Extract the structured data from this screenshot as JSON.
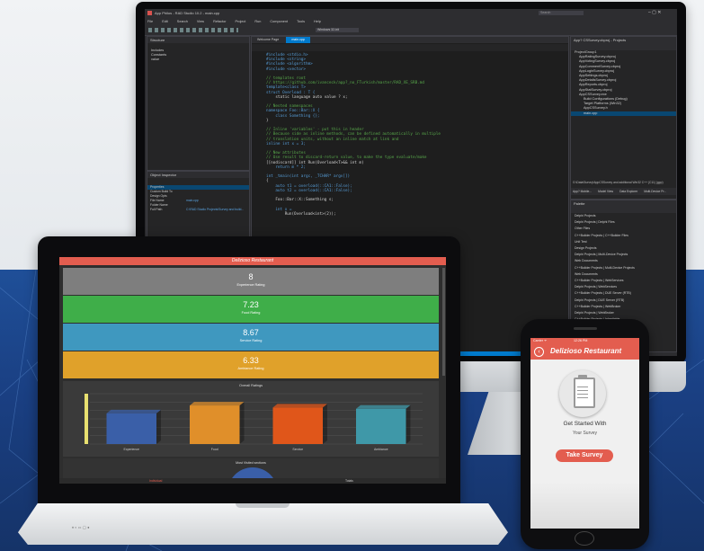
{
  "ide": {
    "title": "App Philos - RAD Studio 10.2 - main.cpp",
    "search_placeholder": "Search",
    "menu": [
      "File",
      "Edit",
      "Search",
      "View",
      "Refactor",
      "Project",
      "Run",
      "Component",
      "Tools",
      "Help"
    ],
    "platform_select": "Windows 32-bit",
    "structure_title": "Structure",
    "structure_items": [
      "Includes",
      "Constants",
      "value"
    ],
    "inspector_title": "Object Inspector",
    "inspector_tabs": [
      "Properties",
      "Events"
    ],
    "inspector_rows": [
      [
        "Properties",
        ""
      ],
      [
        "Custom Build To",
        ""
      ],
      [
        "Design Opts",
        ""
      ],
      [
        "File Name",
        "main.cpp"
      ],
      [
        "Folder Name",
        ""
      ],
      [
        "Full Path",
        "C:\\RAD Studio Projects\\Survey and build..."
      ]
    ],
    "tabs": [
      "Welcome Page",
      "main.cpp"
    ],
    "code_lines": [
      "#include <stdio.h>",
      "#include <string>",
      "#include <algorithm>",
      "#include <vector>",
      "",
      "// templates root",
      "// https://github.com/ivanceck/app?_no_FTurkish/master/RAD_XE_SRB.md",
      "template<class T>",
      "struct Overload : T {",
      "    static language auto value ? x;",
      "",
      "// Nested namespaces",
      "namespace Foo::Bar::X {",
      "    class Something {};",
      "}",
      "",
      "// Inline 'variables' - put this in header",
      "// Because side as inline methods, can be defined automatically in multiple",
      "// translation units, without an inline match at link and",
      "inline int x = 3;",
      "",
      "// New attributes",
      "// Use result to discard-return value, to make the type evaluate/make",
      "[[nodiscard]] int Run(Overload<T>&& int m)",
      "    return m * 2;",
      "",
      "int _tmain(int argc, _TCHAR* argv[])",
      "{",
      "    auto t1 = overload(::CA1::False);",
      "    auto t2 = overload(::CA1::False);",
      "",
      "    Foo::Bar::X::Something s;",
      "",
      "    int x =",
      "        Run(Overload<int>(2));"
    ],
    "project_title": "App? CSSurvey.cbproj - Projects",
    "project_items": [
      "ProjectGroup1",
      "AppRatingSurvey.cbproj",
      "AppVotingSurvey.cbproj",
      "AppCommentSurvey.cbproj",
      "AppLoginSurvey.cbproj",
      "AppSettings.cbproj",
      "AppDetailsSurvey.cbproj",
      "AppReports.cbproj",
      "AppStatSurvey.cbproj",
      "AppCSSurvey.exe",
      "Build Configurations (Debug)",
      "Target Platforms (Win32)",
      "AppCSSurvey.h",
      "main.cpp"
    ],
    "project_status": "G:\\Data\\Survey\\AppCSSurvey and additional Win32 C++ (C11) (gpp)",
    "project_tabs": [
      "App? Mobile...",
      "Model View",
      "Data Explorer",
      "Multi-Device Pr..."
    ],
    "palette_title": "Palette",
    "palette_items": [
      "Delphi Projects",
      "Delphi Projects | Delphi Files",
      "Other Files",
      "C++Builder Projects | C++Builder Files",
      "Unit Test",
      "Design Projects",
      "Delphi Projects | Multi-Device Projects",
      "Web Documents",
      "C++Builder Projects | Multi-Device Projects",
      "Web Documents",
      "C++Builder Projects | WebServices",
      "Delphi Projects | WebServices",
      "C++Builder Projects | DUE Server (RTB)",
      "Delphi Projects | DUE Server (RTB)",
      "C++Builder Projects | WebBroker",
      "Delphi Projects | WebBroker",
      "C++Builder Projects | Inheritable",
      "Delphi Projects | Inheritable",
      "C++Builder Projects | DataSnap Server",
      "Delphi Projects | DataSnap Server"
    ],
    "status_bar": [
      "1: 1",
      "Insert",
      "Modified",
      "Code",
      "Design",
      "History"
    ]
  },
  "laptop": {
    "title": "Delizioso Restaurant",
    "ratings": [
      {
        "value": "8",
        "label": "Experience Rating",
        "color": "#7e7e7e"
      },
      {
        "value": "7.23",
        "label": "Food Rating",
        "color": "#3fae49"
      },
      {
        "value": "8.67",
        "label": "Service Rating",
        "color": "#3f98bf"
      },
      {
        "value": "6.33",
        "label": "Ambiance Rating",
        "color": "#e0a12a"
      }
    ],
    "chart_title": "Overall Ratings",
    "pie_title": "Most Visited sections",
    "footer_left": "Individual",
    "footer_right": "Totals",
    "dock": "♦ ◐ ▭ ◯ ●"
  },
  "chart_data": {
    "type": "bar",
    "title": "Overall Ratings",
    "categories": [
      "Experience",
      "Food",
      "Service",
      "Ambiance"
    ],
    "values": [
      7.3,
      9.2,
      8.7,
      8.4
    ],
    "colors": [
      "#3a5fa8",
      "#e08f2a",
      "#e0561a",
      "#3f98a8"
    ],
    "ylim": [
      0,
      12
    ],
    "grid": true
  },
  "phone": {
    "status_left": "Carrier ᯤ",
    "status_time": "12:26 PM",
    "title": "Delizioso Restaurant",
    "get_started": "Get Started With",
    "subtitle": "Your Survey",
    "button": "Take Survey"
  }
}
